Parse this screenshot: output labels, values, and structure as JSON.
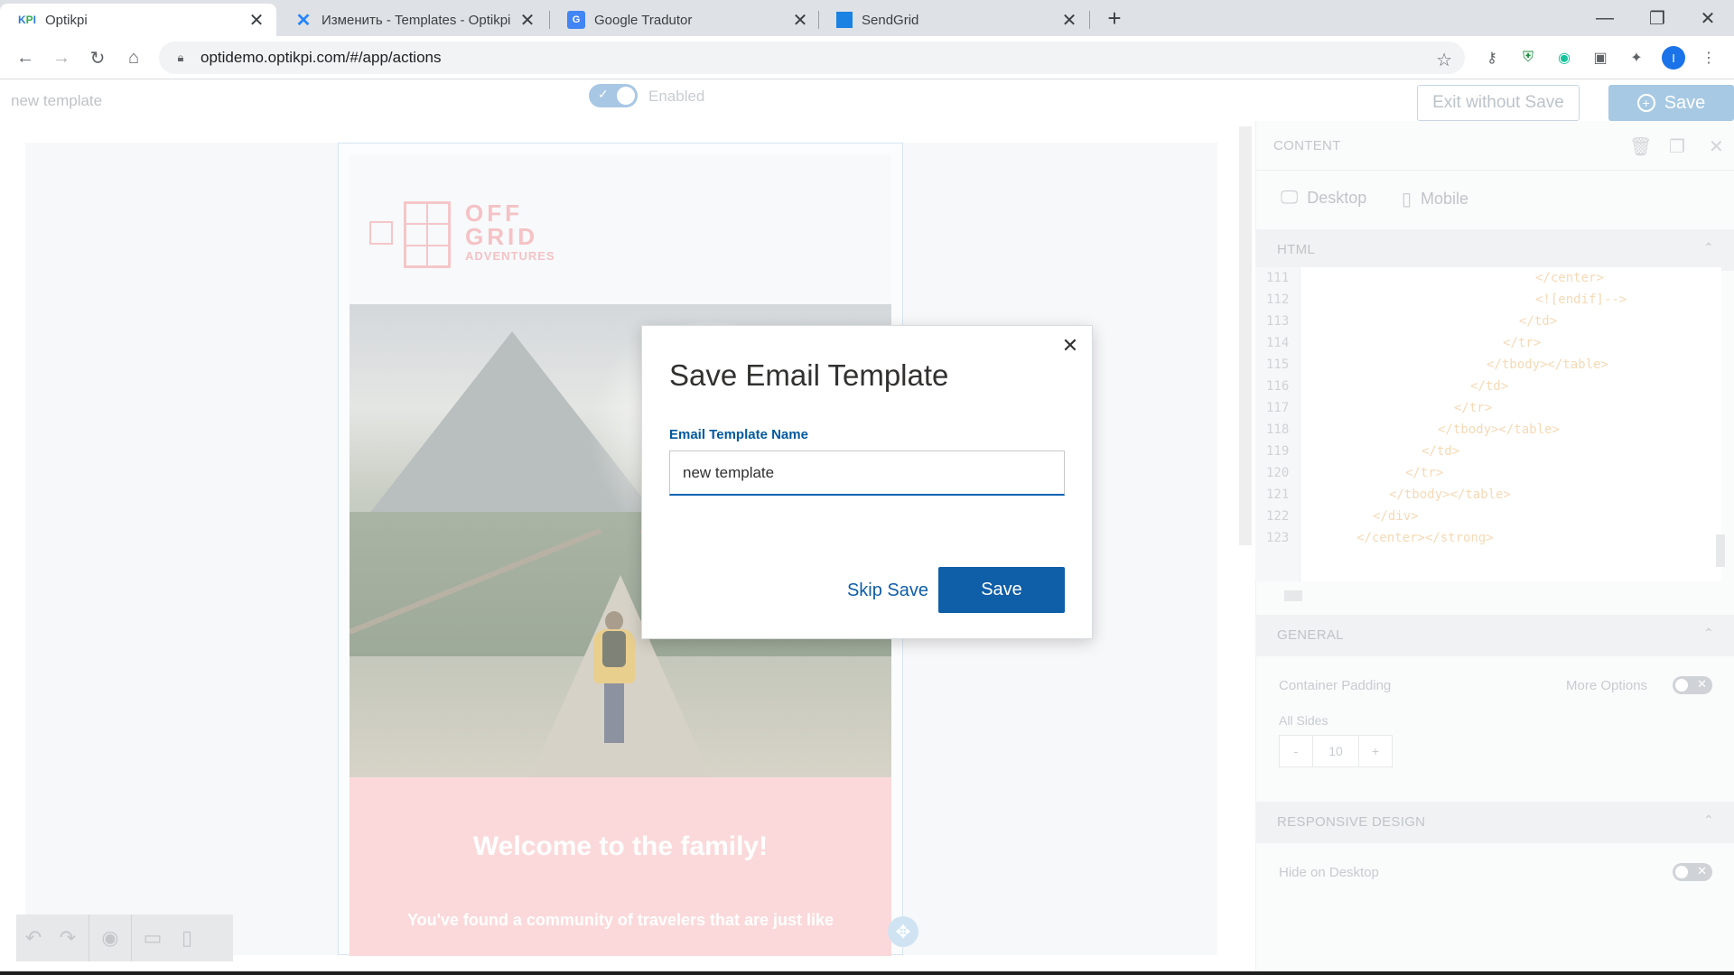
{
  "browser": {
    "tabs": [
      {
        "title": "Optikpi",
        "favicon": "KPI",
        "active": true
      },
      {
        "title": "Изменить - Templates - Optikpi",
        "favicon": "confluence-icon",
        "active": false
      },
      {
        "title": "Google Tradutor",
        "favicon": "google-translate-icon",
        "active": false
      },
      {
        "title": "SendGrid",
        "favicon": "sendgrid-icon",
        "active": false
      }
    ],
    "url": "optidemo.optikpi.com/#/app/actions",
    "profile_initial": "I"
  },
  "header": {
    "template_name": "new template",
    "enabled_label": "Enabled",
    "exit_label": "Exit without Save",
    "save_label": "Save"
  },
  "email_preview": {
    "logo_line1": "OFF",
    "logo_line2": "GRID",
    "logo_line3": "ADVENTURES",
    "headline": "Welcome to the family!",
    "body_text": "You've found a community of travelers that are just like"
  },
  "panel": {
    "title": "CONTENT",
    "device_tabs": [
      "Desktop",
      "Mobile"
    ],
    "html_section": "HTML",
    "code_lines": [
      {
        "n": "111",
        "indent": 14,
        "text": "</center>"
      },
      {
        "n": "112",
        "indent": 14,
        "text": "<![endif]-->"
      },
      {
        "n": "113",
        "indent": 13,
        "text": "</td>"
      },
      {
        "n": "114",
        "indent": 12,
        "text": "</tr>"
      },
      {
        "n": "115",
        "indent": 11,
        "text": "</tbody></table>"
      },
      {
        "n": "116",
        "indent": 10,
        "text": "</td>"
      },
      {
        "n": "117",
        "indent": 9,
        "text": "</tr>"
      },
      {
        "n": "118",
        "indent": 8,
        "text": "</tbody></table>"
      },
      {
        "n": "119",
        "indent": 7,
        "text": "</td>"
      },
      {
        "n": "120",
        "indent": 6,
        "text": "</tr>"
      },
      {
        "n": "121",
        "indent": 5,
        "text": "</tbody></table>"
      },
      {
        "n": "122",
        "indent": 4,
        "text": "</div>"
      },
      {
        "n": "123",
        "indent": 3,
        "text": "</center></strong>"
      }
    ],
    "general_section": "GENERAL",
    "container_padding_label": "Container Padding",
    "more_options_label": "More Options",
    "all_sides_label": "All Sides",
    "padding_minus": "-",
    "padding_value": "10",
    "padding_plus": "+",
    "responsive_section": "RESPONSIVE DESIGN",
    "hide_on_desktop_label": "Hide on Desktop"
  },
  "modal": {
    "title": "Save Email Template",
    "field_label": "Email Template Name",
    "field_value": "new template",
    "skip_label": "Skip Save",
    "save_label": "Save"
  },
  "colors": {
    "primary": "#0f5ea8",
    "code_text": "#f6d9b5",
    "welcome_bg": "#fbd9da"
  }
}
